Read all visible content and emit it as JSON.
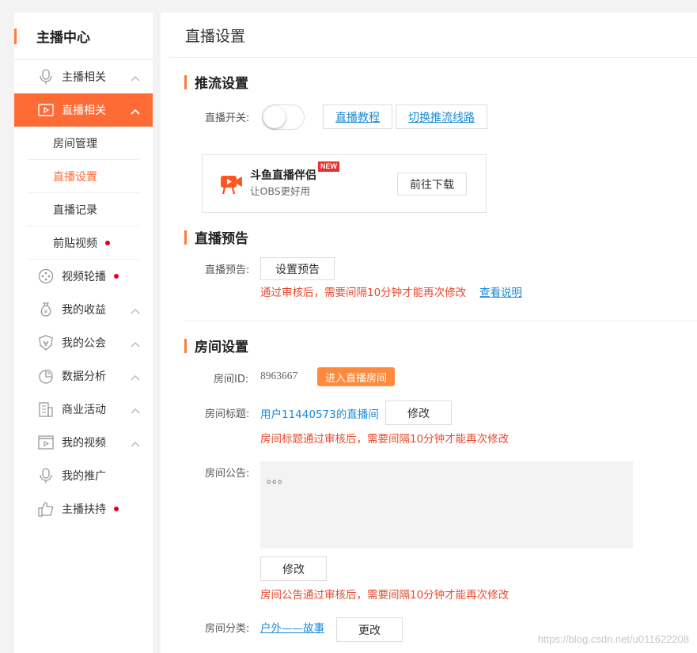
{
  "sidebar": {
    "title": "主播中心",
    "items": [
      {
        "label": "主播相关"
      },
      {
        "label": "直播相关"
      },
      {
        "label": "视频轮播"
      },
      {
        "label": "我的收益"
      },
      {
        "label": "我的公会"
      },
      {
        "label": "数据分析"
      },
      {
        "label": "商业活动"
      },
      {
        "label": "我的视频"
      },
      {
        "label": "我的推广"
      },
      {
        "label": "主播扶持"
      }
    ],
    "subitems": [
      {
        "label": "房间管理"
      },
      {
        "label": "直播设置"
      },
      {
        "label": "直播记录"
      },
      {
        "label": "前贴视频"
      }
    ]
  },
  "main": {
    "page_title": "直播设置",
    "push": {
      "title": "推流设置",
      "switch_label": "直播开关:",
      "tutorial_link": "直播教程",
      "switch_line_link": "切换推流线路",
      "promo_name": "斗鱼直播伴侣",
      "promo_badge": "NEW",
      "promo_sub": "让OBS更好用",
      "promo_button": "前往下载"
    },
    "preview": {
      "title": "直播预告",
      "label": "直播预告:",
      "button": "设置预告",
      "warning": "通过审核后，需要间隔10分钟才能再次修改",
      "link": "查看说明"
    },
    "room": {
      "title": "房间设置",
      "id_label": "房间ID:",
      "id_value": "8963667",
      "enter_button": "进入直播房间",
      "title_label": "房间标题:",
      "title_value": "用户11440573的直播间",
      "modify_button": "修改",
      "title_warning": "房间标题通过审核后，需要间隔10分钟才能再次修改",
      "notice_label": "房间公告:",
      "notice_value": "。。。",
      "notice_modify": "修改",
      "notice_warning": "房间公告通过审核后，需要间隔10分钟才能再次修改",
      "category_label": "房间分类:",
      "category_value": "户外——故事",
      "category_button": "更改"
    }
  },
  "watermark": "https://blog.csdn.net/u011622208",
  "colors": {
    "accent": "#ff6b35",
    "link": "#1a8ad6",
    "warn": "#e64a2e",
    "dot": "#e0001b"
  }
}
